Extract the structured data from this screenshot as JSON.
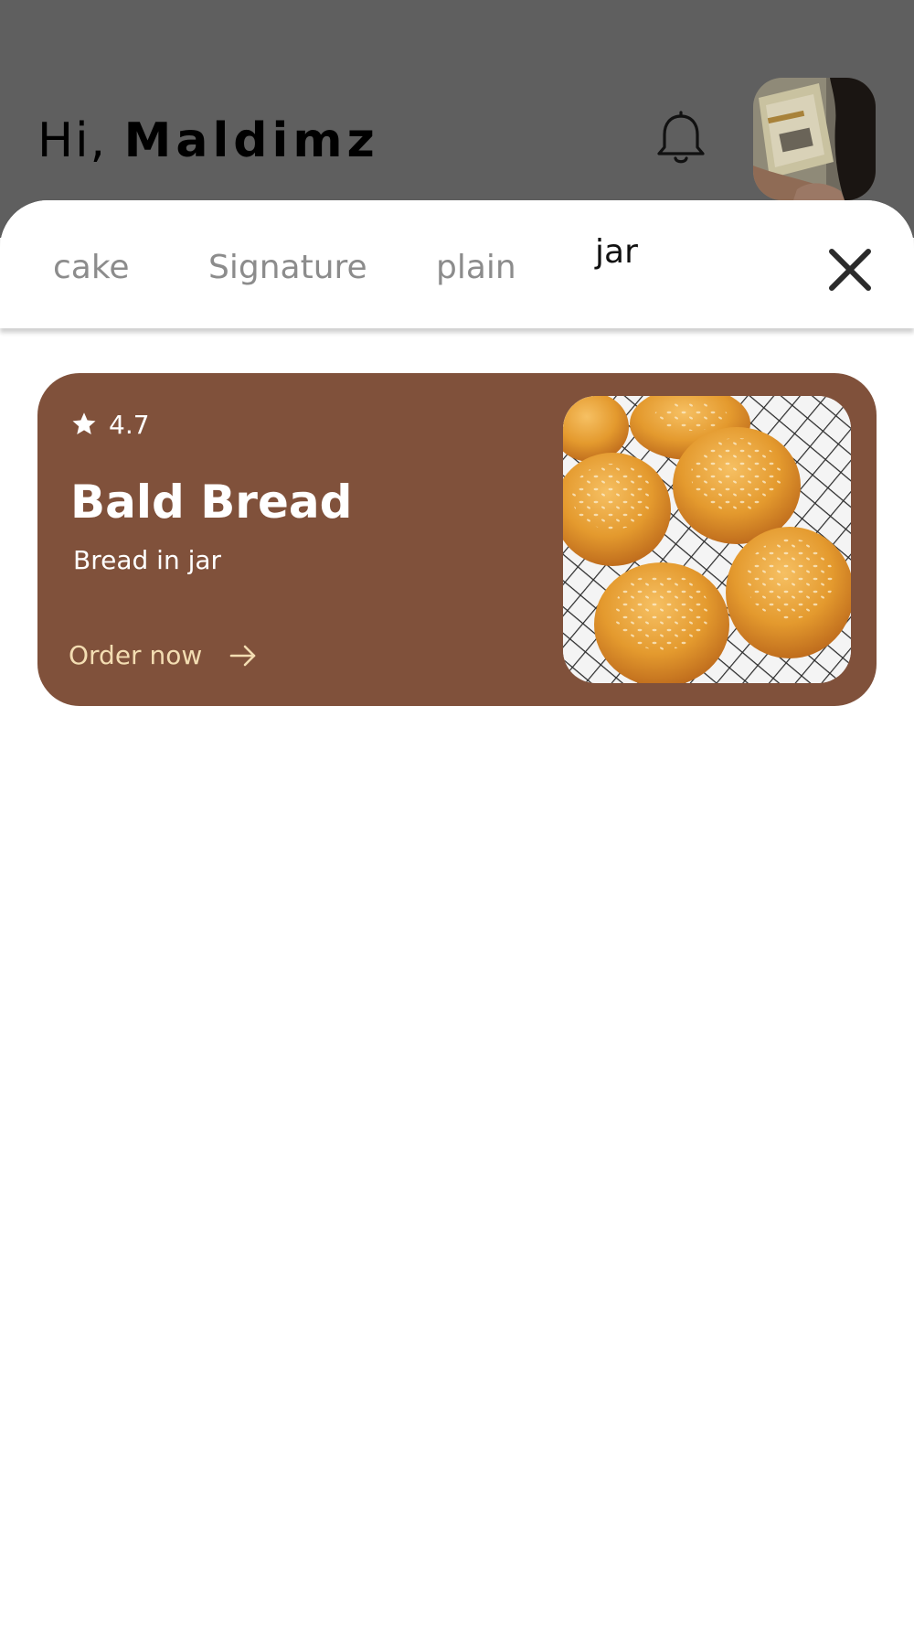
{
  "header": {
    "greeting_prefix": "Hi, ",
    "user_name": "Maldimz"
  },
  "tabs": [
    {
      "label": "cake",
      "active": false
    },
    {
      "label": "Signature",
      "active": false
    },
    {
      "label": "plain",
      "active": false
    },
    {
      "label": "jar",
      "active": true
    }
  ],
  "icons": {
    "notification": "bell-icon",
    "close": "close-icon",
    "rating": "star-icon",
    "order": "arrow-right-icon"
  },
  "products": [
    {
      "rating": "4.7",
      "title": "Bald Bread",
      "subtitle": "Bread in jar",
      "cta": "Order now"
    }
  ],
  "colors": {
    "header_overlay": "#5f5f5f",
    "card_background": "#80513b",
    "cta_text": "#f3ddb2",
    "tab_inactive": "#8c8c8c",
    "tab_active": "#111111"
  }
}
